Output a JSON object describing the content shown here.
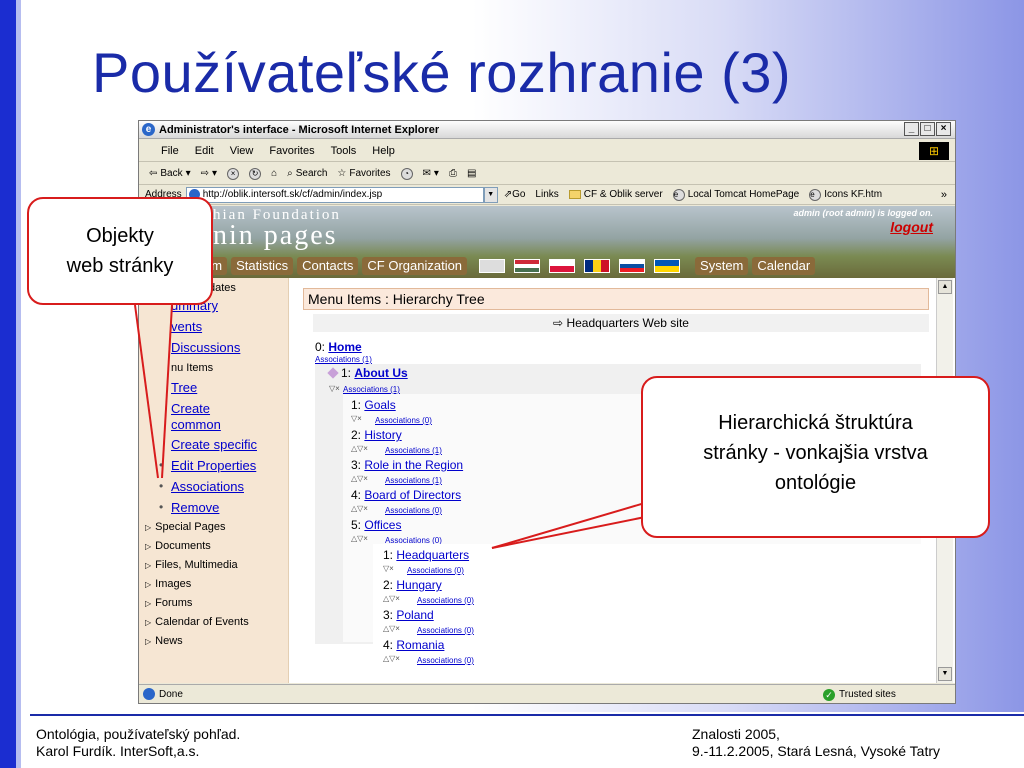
{
  "slide": {
    "title": "Používateľské rozhranie (3)",
    "footer_left_1": "Ontológia, používateľský pohľad.",
    "footer_left_2": "Karol Furdík. InterSoft,a.s.",
    "footer_right_1": "Znalosti 2005,",
    "footer_right_2": "9.-11.2.2005, Stará Lesná, Vysoké Tatry"
  },
  "window": {
    "title": "Administrator's interface - Microsoft Internet Explorer",
    "menu": [
      "File",
      "Edit",
      "View",
      "Favorites",
      "Tools",
      "Help"
    ],
    "toolbar": {
      "back": "Back",
      "search": "Search",
      "favorites": "Favorites"
    },
    "address_label": "Address",
    "address_value": "http://oblik.intersoft.sk/cf/admin/index.jsp",
    "go": "Go",
    "links_label": "Links",
    "links": [
      "CF & Oblik server",
      "Local Tomcat HomePage",
      "Icons KF.htm"
    ],
    "status_done": "Done",
    "status_zone": "Trusted sites"
  },
  "banner": {
    "line1": "hian Foundation",
    "line2": "nin pages",
    "logged": "admin (root admin) is logged on.",
    "logout": "logout",
    "nav": [
      "em",
      "Statistics",
      "Contacts",
      "CF Organization",
      "System",
      "Calendar"
    ]
  },
  "sidebar": {
    "updates": "dates",
    "summary": "ummary",
    "events": "vents",
    "discussions": "Discussions",
    "menu_items": "nu Items",
    "tree": "Tree",
    "create_common_1": "Create",
    "create_common_2": "common",
    "create_specific": "Create specific",
    "edit_properties": "Edit Properties",
    "associations": "Associations",
    "remove": "Remove",
    "sections": [
      "Special Pages",
      "Documents",
      "Files, Multimedia",
      "Images",
      "Forums",
      "Calendar of Events",
      "News"
    ]
  },
  "content": {
    "header": "Menu Items  :  Hierarchy Tree",
    "site": "Headquarters Web site",
    "root_num": "0:",
    "root": "Home",
    "root_assoc": "Associations (1)",
    "l1_num": "1:",
    "l1": "About Us",
    "l1_assoc": "Associations (1)",
    "children": [
      {
        "num": "1:",
        "label": "Goals",
        "assoc": "Associations (0)"
      },
      {
        "num": "2:",
        "label": "History",
        "assoc": "Associations (1)"
      },
      {
        "num": "3:",
        "label": "Role in the Region",
        "assoc": "Associations (1)"
      },
      {
        "num": "4:",
        "label": "Board of Directors",
        "assoc": "Associations (0)"
      },
      {
        "num": "5:",
        "label": "Offices",
        "assoc": "Associations (0)"
      }
    ],
    "offices": [
      {
        "num": "1:",
        "label": "Headquarters",
        "assoc": "Associations (0)"
      },
      {
        "num": "2:",
        "label": "Hungary",
        "assoc": "Associations (0)"
      },
      {
        "num": "3:",
        "label": "Poland",
        "assoc": "Associations (0)"
      },
      {
        "num": "4:",
        "label": "Romania",
        "assoc": "Associations (0)"
      }
    ]
  },
  "callouts": {
    "left_1": "Objekty",
    "left_2": "web stránky",
    "right_1": "Hierarchická štruktúra",
    "right_2": "stránky - vonkajšia vrstva",
    "right_3": "ontológie"
  },
  "colors": {
    "title": "#1a2ba8",
    "callout_border": "#d81c1c",
    "link": "#0000cc"
  }
}
